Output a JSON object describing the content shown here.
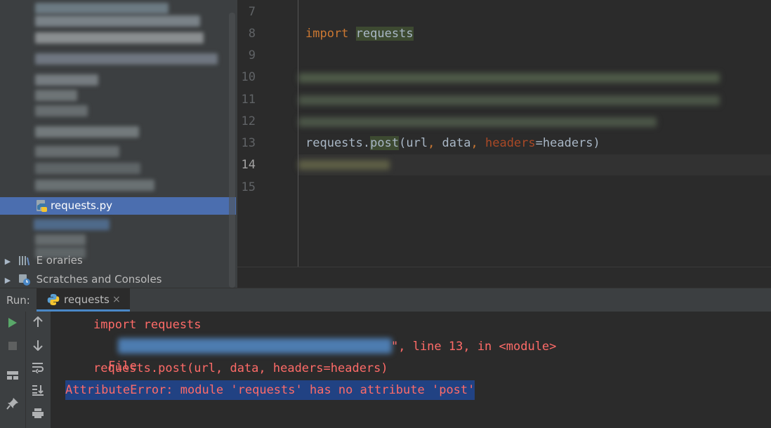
{
  "project_panel": {
    "selected_file": "requests.py",
    "rows": [
      {
        "id": "external-libraries",
        "label": "External Libraries",
        "visible_label": "E        oraries"
      },
      {
        "id": "scratches",
        "label": "Scratches and Consoles"
      }
    ]
  },
  "editor": {
    "lines": [
      {
        "n": "7"
      },
      {
        "n": "8"
      },
      {
        "n": "9"
      },
      {
        "n": "10"
      },
      {
        "n": "11"
      },
      {
        "n": "12"
      },
      {
        "n": "13"
      },
      {
        "n": "14"
      },
      {
        "n": "15"
      }
    ],
    "import_kw": "import",
    "import_module": "requests",
    "call": {
      "obj": "requests",
      "dot": ".",
      "method": "post",
      "open": "(",
      "arg1": "url",
      "comma1": ", ",
      "arg2": "data",
      "comma2": ", ",
      "kwarg_name": "headers",
      "eq": "=",
      "kwarg_value": "headers",
      "close": ")"
    }
  },
  "run": {
    "label": "Run:",
    "tab_label": "requests",
    "close_glyph": "×"
  },
  "console": {
    "line1": "import requests",
    "file_prefix": "File ",
    "file_suffix": "\", line 13, in <module>",
    "line3": "requests.post(url, data, headers=headers)",
    "error": "AttributeError: module 'requests' has no attribute 'post'"
  },
  "colors": {
    "panel_bg": "#3c3f41",
    "editor_bg": "#2b2b2b",
    "selection": "#4b6eaf",
    "keyword": "#cc7832",
    "param": "#aa4926",
    "error_text": "#ff6b68",
    "error_highlight": "#214283"
  }
}
